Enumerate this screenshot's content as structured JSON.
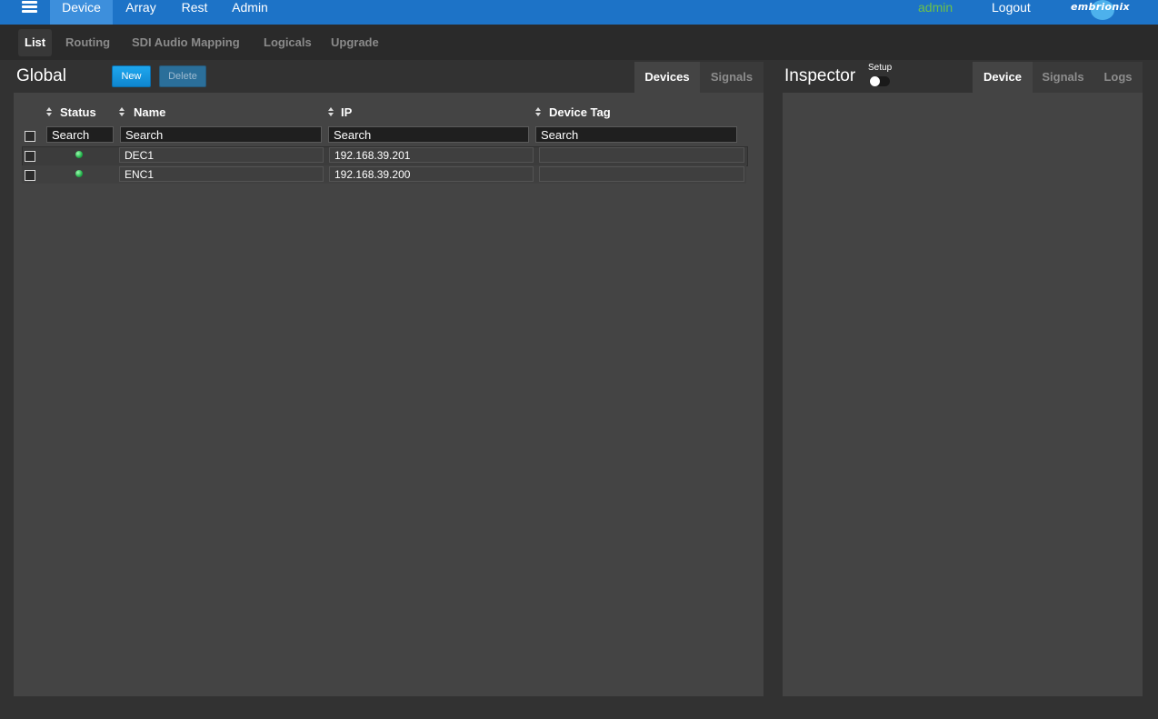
{
  "topnav": {
    "items": [
      {
        "label": "Device",
        "active": true
      },
      {
        "label": "Array"
      },
      {
        "label": "Rest"
      },
      {
        "label": "Admin"
      }
    ],
    "user": "admin",
    "logout": "Logout",
    "logo": "embrionix",
    "user_color": "#6cc04a",
    "accent": "#1d73c7"
  },
  "subnav": {
    "items": [
      {
        "label": "List",
        "active": true
      },
      {
        "label": "Routing"
      },
      {
        "label": "SDI Audio Mapping"
      },
      {
        "label": "Logicals"
      },
      {
        "label": "Upgrade"
      }
    ]
  },
  "global": {
    "title": "Global",
    "new_label": "New",
    "delete_label": "Delete",
    "tabs": [
      {
        "label": "Devices",
        "active": true
      },
      {
        "label": "Signals"
      }
    ],
    "table": {
      "columns": [
        "Status",
        "Name",
        "IP",
        "Device Tag"
      ],
      "search_placeholder": "Search",
      "rows": [
        {
          "status": "online",
          "status_color": "#22b04a",
          "name": "DEC1",
          "ip": "192.168.39.201",
          "tag": ""
        },
        {
          "status": "online",
          "status_color": "#22b04a",
          "name": "ENC1",
          "ip": "192.168.39.200",
          "tag": ""
        }
      ]
    }
  },
  "inspector": {
    "title": "Inspector",
    "setup_label": "Setup",
    "setup_enabled": false,
    "tabs": [
      {
        "label": "Device",
        "active": true
      },
      {
        "label": "Signals"
      },
      {
        "label": "Logs"
      }
    ]
  }
}
